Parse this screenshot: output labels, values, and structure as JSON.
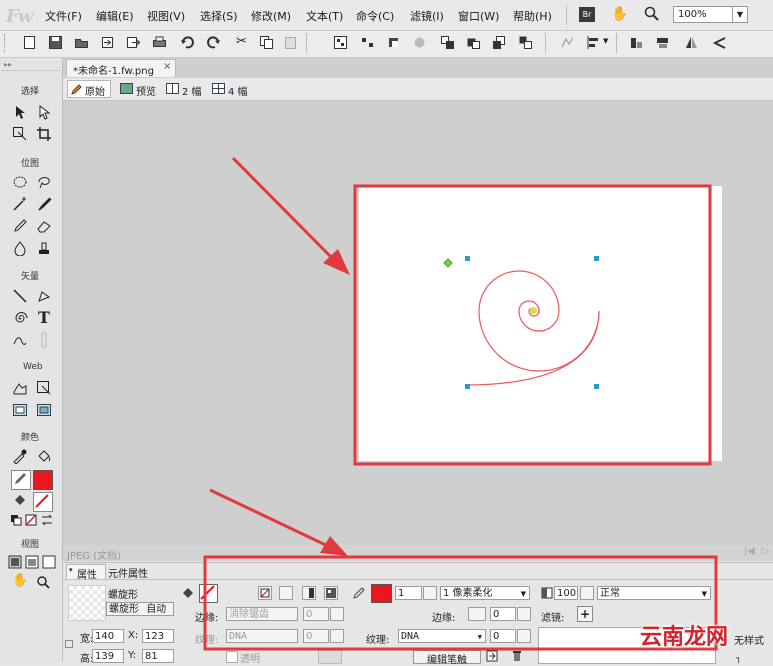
{
  "app": {
    "logo": "Fw"
  },
  "menu": [
    "文件(F)",
    "编辑(E)",
    "视图(V)",
    "选择(S)",
    "修改(M)",
    "文本(T)",
    "命令(C)",
    "滤镜(I)",
    "窗口(W)",
    "帮助(H)"
  ],
  "menu_right": {
    "br_label": "Br",
    "zoom": "100%"
  },
  "document": {
    "tab_title": "*未命名-1.fw.png",
    "tab_close": "×",
    "view_tabs": [
      "原始",
      "预览",
      "2 幅",
      "4 幅"
    ],
    "status": "JPEG (文档)"
  },
  "tools": {
    "sections": [
      "选择",
      "位图",
      "矢量",
      "Web",
      "颜色",
      "视图"
    ]
  },
  "props": {
    "tabs": [
      "属性",
      "元件属性"
    ],
    "object_name": "螺旋形",
    "object_type": "螺旋形",
    "object_mode": "自动",
    "edge_label": "边缘:",
    "edge_value": "消除锯齿",
    "edge_num": "0",
    "texture_label": "纹理:",
    "texture_value": "DNA",
    "texture_num": "0",
    "transparent_label": "透明",
    "width_label": "宽:",
    "width_value": "140",
    "x_label": "X:",
    "x_value": "123",
    "height_label": "高:",
    "height_value": "139",
    "y_label": "Y:",
    "y_value": "81",
    "stroke_size": "1",
    "stroke_type": "1 像素柔化",
    "stroke_edge_label": "边缘:",
    "stroke_edge_value": "0",
    "stroke_texture_label": "纹理:",
    "stroke_texture_value": "DNA",
    "stroke_texture_num": "0",
    "edit_stroke_label": "编辑笔触",
    "opacity": "100",
    "blend": "正常",
    "filters_label": "滤镜:",
    "filters_add": "+",
    "style_label": "无样式"
  },
  "watermark": "云南龙网",
  "colors": {
    "accent_red": "#e03a3e",
    "stroke_color": "#ff0000",
    "handle": "#2b9bd6"
  }
}
